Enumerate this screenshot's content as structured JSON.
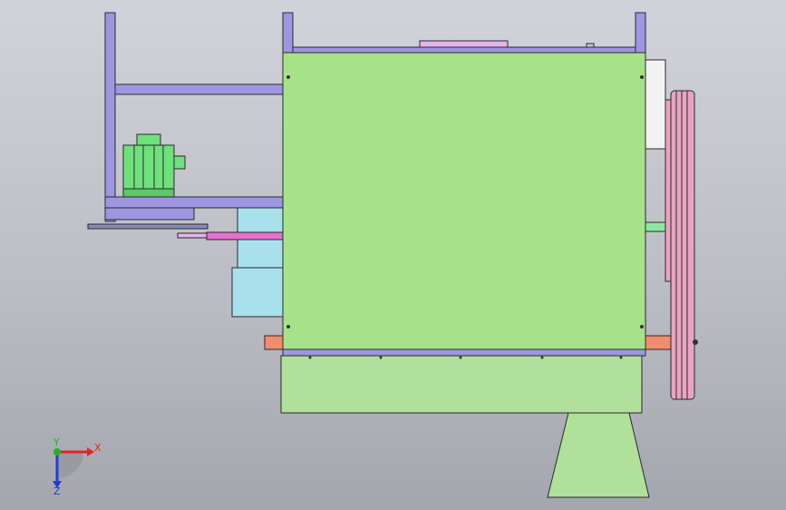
{
  "triad": {
    "x_label": "X",
    "y_label": "Y",
    "z_label": "Z"
  },
  "colors": {
    "frame": "#9e96e0",
    "housing": "#a6e28a",
    "base": "#b0e09a",
    "motor": "#6ee07c",
    "pulley": "#e8a4c0",
    "shaft": "#e86ed0",
    "hopper": "#a8e0ec",
    "coupling": "#f28c6e",
    "axis_x": "#e8221f",
    "axis_y": "#22b422",
    "axis_z": "#1f3cd8"
  },
  "parts": [
    "left-frame",
    "motor",
    "main-housing",
    "base-block",
    "support-leg",
    "belt-pulley",
    "feed-hopper",
    "drive-shaft"
  ]
}
